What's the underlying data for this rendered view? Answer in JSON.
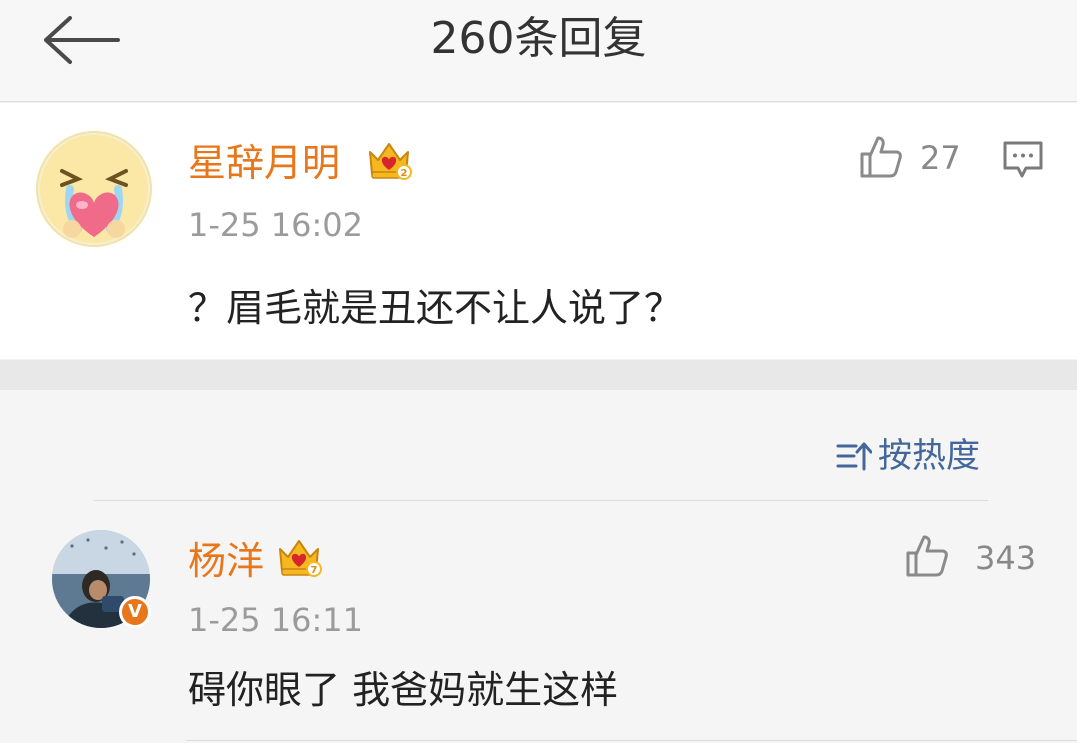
{
  "header": {
    "title": "260条回复"
  },
  "main_comment": {
    "user": "星辞月明",
    "level": "2",
    "time": "1-25 16:02",
    "text": "？眉毛就是丑还不让人说了？",
    "likes": "27"
  },
  "sort": {
    "label": "按热度"
  },
  "replies": [
    {
      "user": "杨洋",
      "level": "7",
      "verified": "V",
      "time": "1-25 16:11",
      "text": "碍你眼了 我爸妈就生这样",
      "likes": "343"
    }
  ],
  "colors": {
    "username": "#e8761a",
    "link": "#43679b",
    "crown": "#f5b820",
    "crown_heart": "#d7262b"
  }
}
